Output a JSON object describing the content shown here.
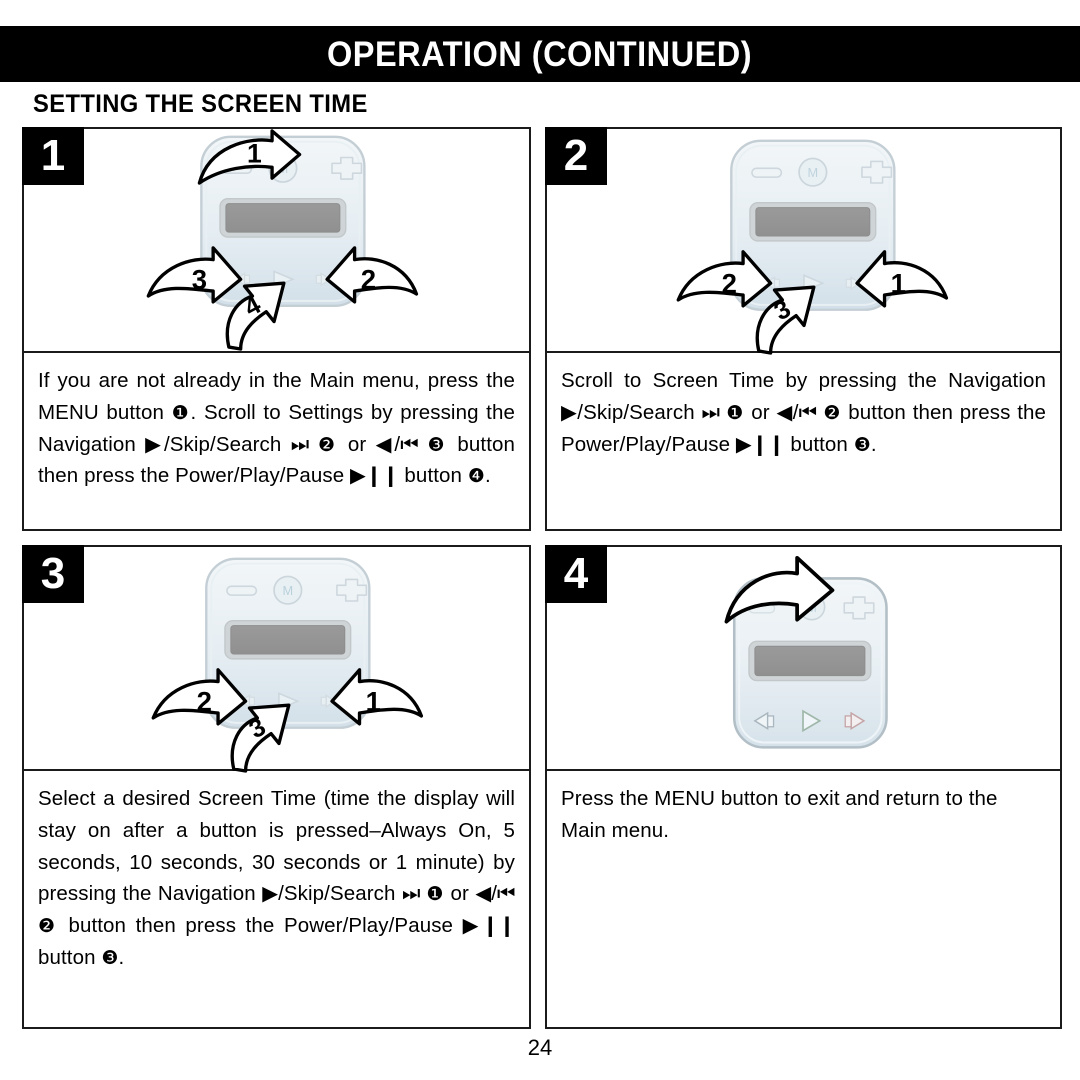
{
  "document": {
    "header_title": "OPERATION (CONTINUED)",
    "section_title": "SETTING THE SCREEN TIME",
    "page_number": "24"
  },
  "colors": {
    "header_background": "#000000",
    "header_text": "#ffffff",
    "panel_border": "#1b1b1b",
    "device_body_top": "#eef3f6",
    "device_body_bottom": "#d5e2ea",
    "device_outline": "#b9c7cf",
    "device_screen_fill": "#969696",
    "device_screen_bezel": "#cfd4d6",
    "page_background": "#ffffff"
  },
  "steps": [
    {
      "badge": "1",
      "figure": {
        "device_name": "portable-media-player",
        "arrows": [
          {
            "label": "1",
            "target": "menu-button"
          },
          {
            "label": "2",
            "target": "skip-search-forward-button"
          },
          {
            "label": "3",
            "target": "skip-search-back-button"
          },
          {
            "label": "4",
            "target": "power-play-pause-button"
          }
        ],
        "device_controls": [
          "volume-down-button",
          "menu-button",
          "volume-up-button",
          "lcd-screen",
          "skip-search-back-button",
          "power-play-pause-button",
          "skip-search-forward-button"
        ]
      },
      "text_runs": [
        {
          "t": "If you are not already in the Main menu, press the MENU button "
        },
        {
          "t": "❶",
          "k": "num"
        },
        {
          "t": ". Scroll to Settings by pressing the Navigation "
        },
        {
          "t": "▶",
          "k": "g"
        },
        {
          "t": "/Skip/Search "
        },
        {
          "t": "⏭",
          "k": "g"
        },
        {
          "t": " "
        },
        {
          "t": "❷",
          "k": "num"
        },
        {
          "t": " or "
        },
        {
          "t": "◀",
          "k": "g"
        },
        {
          "t": "/"
        },
        {
          "t": "⏮",
          "k": "g"
        },
        {
          "t": " "
        },
        {
          "t": "❸",
          "k": "num"
        },
        {
          "t": " button then press the Power/Play/Pause "
        },
        {
          "t": "▶❙❙",
          "k": "g"
        },
        {
          "t": " button "
        },
        {
          "t": "❹",
          "k": "num"
        },
        {
          "t": "."
        }
      ]
    },
    {
      "badge": "2",
      "figure": {
        "device_name": "portable-media-player",
        "arrows": [
          {
            "label": "1",
            "target": "skip-search-forward-button"
          },
          {
            "label": "2",
            "target": "skip-search-back-button"
          },
          {
            "label": "3",
            "target": "power-play-pause-button"
          }
        ],
        "device_controls": [
          "volume-down-button",
          "menu-button",
          "volume-up-button",
          "lcd-screen",
          "skip-search-back-button",
          "power-play-pause-button",
          "skip-search-forward-button"
        ]
      },
      "text_runs": [
        {
          "t": "Scroll to Screen Time by pressing the Navigation "
        },
        {
          "t": "▶",
          "k": "g"
        },
        {
          "t": "/Skip/Search "
        },
        {
          "t": "⏭",
          "k": "g"
        },
        {
          "t": " "
        },
        {
          "t": "❶",
          "k": "num"
        },
        {
          "t": " or "
        },
        {
          "t": "◀",
          "k": "g"
        },
        {
          "t": "/"
        },
        {
          "t": "⏮",
          "k": "g"
        },
        {
          "t": " "
        },
        {
          "t": "❷",
          "k": "num"
        },
        {
          "t": " button then press the Power/Play/Pause "
        },
        {
          "t": "▶❙❙",
          "k": "g"
        },
        {
          "t": " button "
        },
        {
          "t": "❸",
          "k": "num"
        },
        {
          "t": "."
        }
      ]
    },
    {
      "badge": "3",
      "figure": {
        "device_name": "portable-media-player",
        "arrows": [
          {
            "label": "1",
            "target": "skip-search-forward-button"
          },
          {
            "label": "2",
            "target": "skip-search-back-button"
          },
          {
            "label": "3",
            "target": "power-play-pause-button"
          }
        ],
        "device_controls": [
          "volume-down-button",
          "menu-button",
          "volume-up-button",
          "lcd-screen",
          "skip-search-back-button",
          "power-play-pause-button",
          "skip-search-forward-button"
        ]
      },
      "text_runs": [
        {
          "t": "Select a desired Screen Time (time the display will stay on after a button is pressed–Always On, 5 seconds, 10 seconds, 30 seconds or 1 minute) by pressing the Navigation "
        },
        {
          "t": "▶",
          "k": "g"
        },
        {
          "t": "/Skip/Search "
        },
        {
          "t": "⏭",
          "k": "g"
        },
        {
          "t": " "
        },
        {
          "t": "❶",
          "k": "num"
        },
        {
          "t": " or "
        },
        {
          "t": "◀",
          "k": "g"
        },
        {
          "t": "/"
        },
        {
          "t": "⏮",
          "k": "g"
        },
        {
          "t": " "
        },
        {
          "t": "❷",
          "k": "num"
        },
        {
          "t": " button then press the Power/Play/Pause "
        },
        {
          "t": "▶❙❙",
          "k": "g"
        },
        {
          "t": " button "
        },
        {
          "t": "❸",
          "k": "num"
        },
        {
          "t": "."
        }
      ]
    },
    {
      "badge": "4",
      "figure": {
        "device_name": "portable-media-player",
        "arrows": [
          {
            "label": "",
            "target": "menu-button"
          }
        ],
        "device_controls": [
          "volume-down-button",
          "menu-button",
          "volume-up-button",
          "lcd-screen",
          "skip-search-back-button",
          "power-play-pause-button",
          "skip-search-forward-button"
        ]
      },
      "text_runs": [
        {
          "t": "Press the MENU button to exit and return to the Main menu."
        }
      ]
    }
  ]
}
